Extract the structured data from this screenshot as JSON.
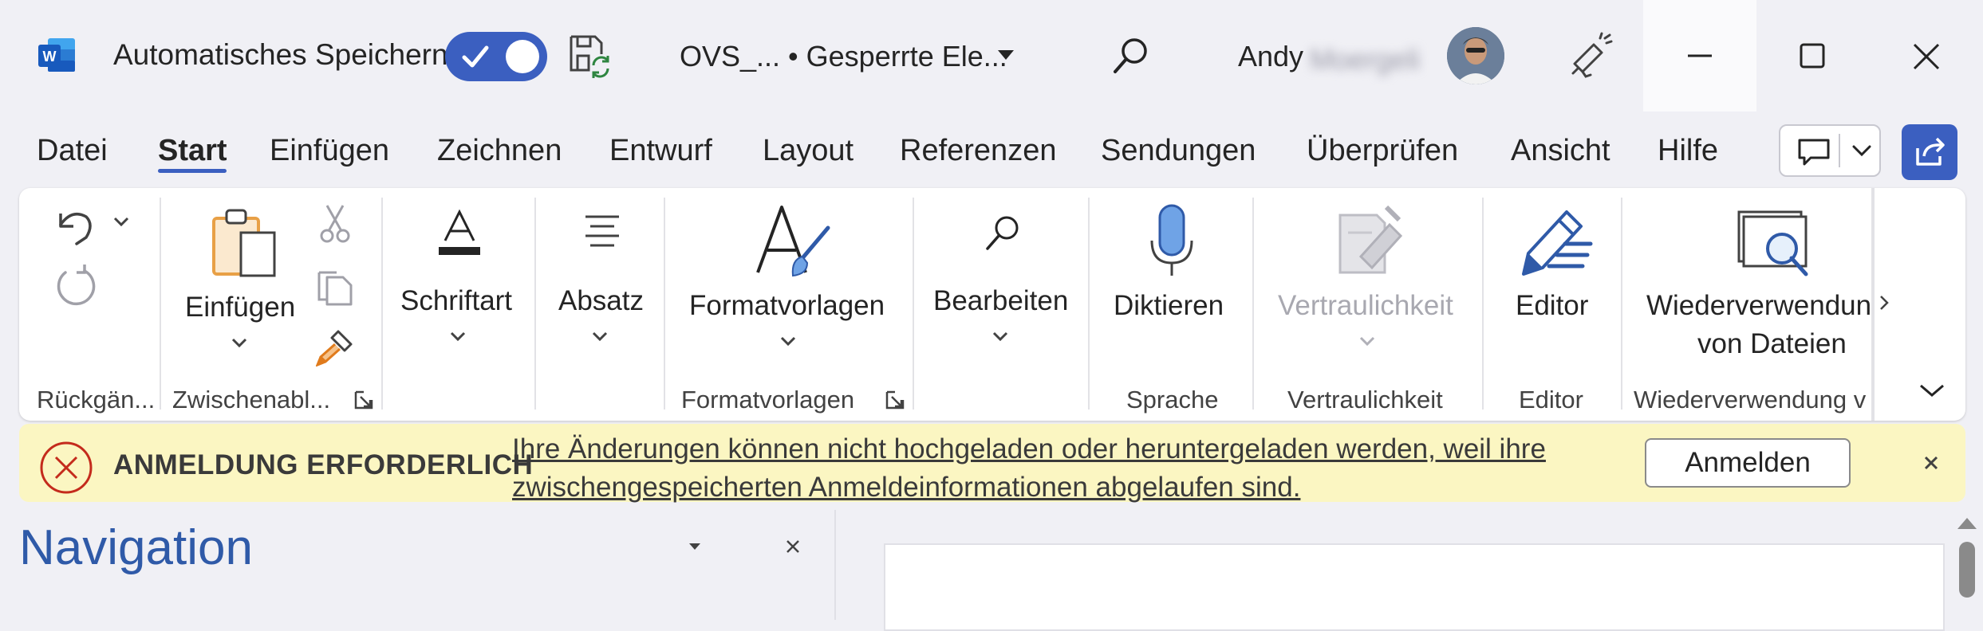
{
  "titlebar": {
    "autosave_label": "Automatisches Speichern",
    "autosave_on": true,
    "document_title": "OVS_... • Gesperrte Ele...",
    "user_first_name": "Andy",
    "user_last_name_blurred": "Moergeli",
    "accent_color": "#3b5fc0"
  },
  "tabs": [
    {
      "label": "Datei",
      "active": false
    },
    {
      "label": "Start",
      "active": true
    },
    {
      "label": "Einfügen",
      "active": false
    },
    {
      "label": "Zeichnen",
      "active": false
    },
    {
      "label": "Entwurf",
      "active": false
    },
    {
      "label": "Layout",
      "active": false
    },
    {
      "label": "Referenzen",
      "active": false
    },
    {
      "label": "Sendungen",
      "active": false
    },
    {
      "label": "Überprüfen",
      "active": false
    },
    {
      "label": "Ansicht",
      "active": false
    },
    {
      "label": "Hilfe",
      "active": false
    }
  ],
  "ribbon": {
    "undo_group_label": "Rückgän...",
    "clipboard": {
      "paste_label": "Einfügen",
      "group_label": "Zwischenabl..."
    },
    "font": {
      "label": "Schriftart"
    },
    "paragraph": {
      "label": "Absatz"
    },
    "styles": {
      "label": "Formatvorlagen",
      "group_label": "Formatvorlagen"
    },
    "editing": {
      "label": "Bearbeiten"
    },
    "voice": {
      "label": "Diktieren",
      "group_label": "Sprache"
    },
    "sensitivity": {
      "label": "Vertraulichkeit",
      "group_label": "Vertraulichkeit"
    },
    "editor": {
      "label": "Editor",
      "group_label": "Editor"
    },
    "reuse": {
      "label_line1": "Wiederverwendun",
      "label_line2": "von Dateien",
      "group_label": "Wiederverwendung v"
    }
  },
  "message_bar": {
    "title": "ANMELDUNG ERFORDERLICH",
    "text": "Ihre Änderungen können nicht hochgeladen oder heruntergeladen werden, weil ihre zwischengespeicherten Anmeldeinformationen abgelaufen sind.",
    "action_label": "Anmelden",
    "error_color": "#c42b1c"
  },
  "navigation": {
    "title": "Navigation"
  }
}
